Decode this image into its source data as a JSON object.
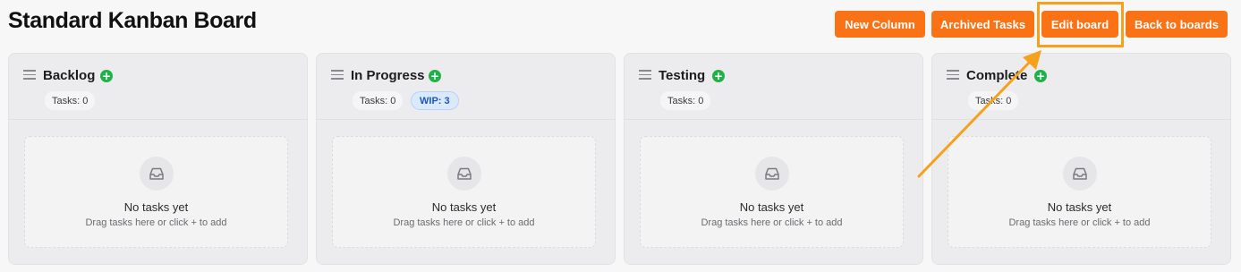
{
  "header": {
    "title": "Standard Kanban Board",
    "buttons": {
      "new_column": "New Column",
      "archived_tasks": "Archived Tasks",
      "edit_board": "Edit board",
      "back_to_boards": "Back to boards"
    }
  },
  "colors": {
    "accent": "#f97316",
    "add_button": "#22b04a",
    "annotation": "#f5a11c",
    "wip_text": "#1a56c8"
  },
  "columns": [
    {
      "title": "Backlog",
      "task_count": "Tasks: 0",
      "wip": null
    },
    {
      "title": "In Progress",
      "task_count": "Tasks: 0",
      "wip": "WIP: 3"
    },
    {
      "title": "Testing",
      "task_count": "Tasks: 0",
      "wip": null
    },
    {
      "title": "Complete",
      "task_count": "Tasks: 0",
      "wip": null
    }
  ],
  "empty_state": {
    "title": "No tasks yet",
    "hint": "Drag tasks here or click + to add",
    "icon": "inbox-icon"
  },
  "add_symbol": "+"
}
